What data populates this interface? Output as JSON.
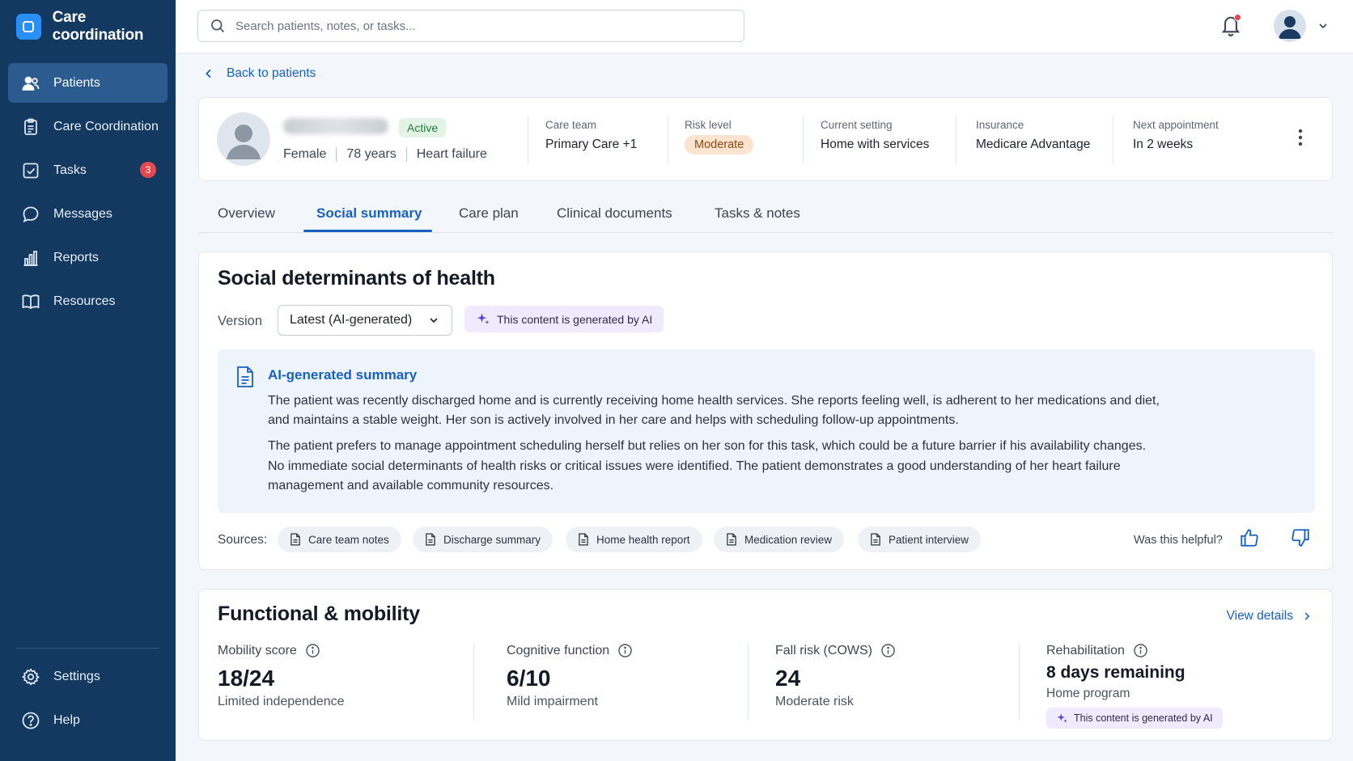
{
  "app": {
    "name": "Care coordination"
  },
  "sidebar": {
    "items": [
      {
        "label": "Patients",
        "icon": "people-icon",
        "active": true
      },
      {
        "label": "Care Coordination",
        "icon": "clipboard-icon"
      },
      {
        "label": "Tasks",
        "icon": "checkbox-icon",
        "badge": "3"
      },
      {
        "label": "Messages",
        "icon": "chat-icon"
      },
      {
        "label": "Reports",
        "icon": "bar-chart-icon"
      },
      {
        "label": "Resources",
        "icon": "book-icon"
      }
    ],
    "bottom": [
      {
        "label": "Settings",
        "icon": "gear-icon"
      },
      {
        "label": "Help",
        "icon": "help-icon"
      }
    ]
  },
  "topbar": {
    "search_placeholder": "Search patients, notes, or tasks..."
  },
  "back_link": "Back to patients",
  "patient": {
    "status": "Active",
    "sex": "Female",
    "age": "78 years",
    "condition": "Heart failure",
    "fields": [
      {
        "label": "Care team",
        "value": "Primary Care +1"
      },
      {
        "label": "Risk level",
        "value": "Moderate"
      },
      {
        "label": "Current setting",
        "value": "Home with services"
      },
      {
        "label": "Insurance",
        "value": "Medicare Advantage"
      },
      {
        "label": "Next appointment",
        "value": "In 2 weeks"
      }
    ]
  },
  "tabs": [
    "Overview",
    "Social summary",
    "Care plan",
    "Clinical documents",
    "Tasks & notes"
  ],
  "active_tab": "Social summary",
  "sdoh": {
    "title": "Social determinants of health",
    "version_label": "Version",
    "version_value": "Latest (AI-generated)",
    "ai_notice": "This content is generated by AI",
    "summary_title": "AI-generated summary",
    "paragraphs": [
      "The patient was recently discharged home and is currently receiving home health services. She reports feeling well, is adherent to her medications and diet, and maintains a stable weight. Her son is actively involved in her care and helps with scheduling follow-up appointments.",
      "The patient prefers to manage appointment scheduling herself but relies on her son for this task, which could be a future barrier if his availability changes.",
      "No immediate social determinants of health risks or critical issues were identified. The patient demonstrates a good understanding of her heart failure management and available community resources."
    ],
    "sources_label": "Sources:",
    "sources": [
      "Care team notes",
      "Discharge summary",
      "Home health report",
      "Medication review",
      "Patient interview"
    ],
    "helpful_label": "Was this helpful?"
  },
  "functional": {
    "title": "Functional & mobility",
    "view_details": "View details",
    "metrics": [
      {
        "label": "Mobility score",
        "value": "18/24",
        "sub": "Limited independence"
      },
      {
        "label": "Cognitive function",
        "value": "6/10",
        "sub": "Mild impairment"
      },
      {
        "label": "Fall risk (COWS)",
        "value": "24",
        "sub": "Moderate risk"
      },
      {
        "label": "Rehabilitation",
        "value": "8 days remaining",
        "sub": "Home program",
        "ai_notice": "This content is generated by AI"
      }
    ]
  },
  "colors": {
    "sidebar": "#143961",
    "accent": "#1760c2",
    "badge": "#e5484d",
    "active_status": "#1f7a3b",
    "risk_moderate": "#fbe3cf"
  }
}
